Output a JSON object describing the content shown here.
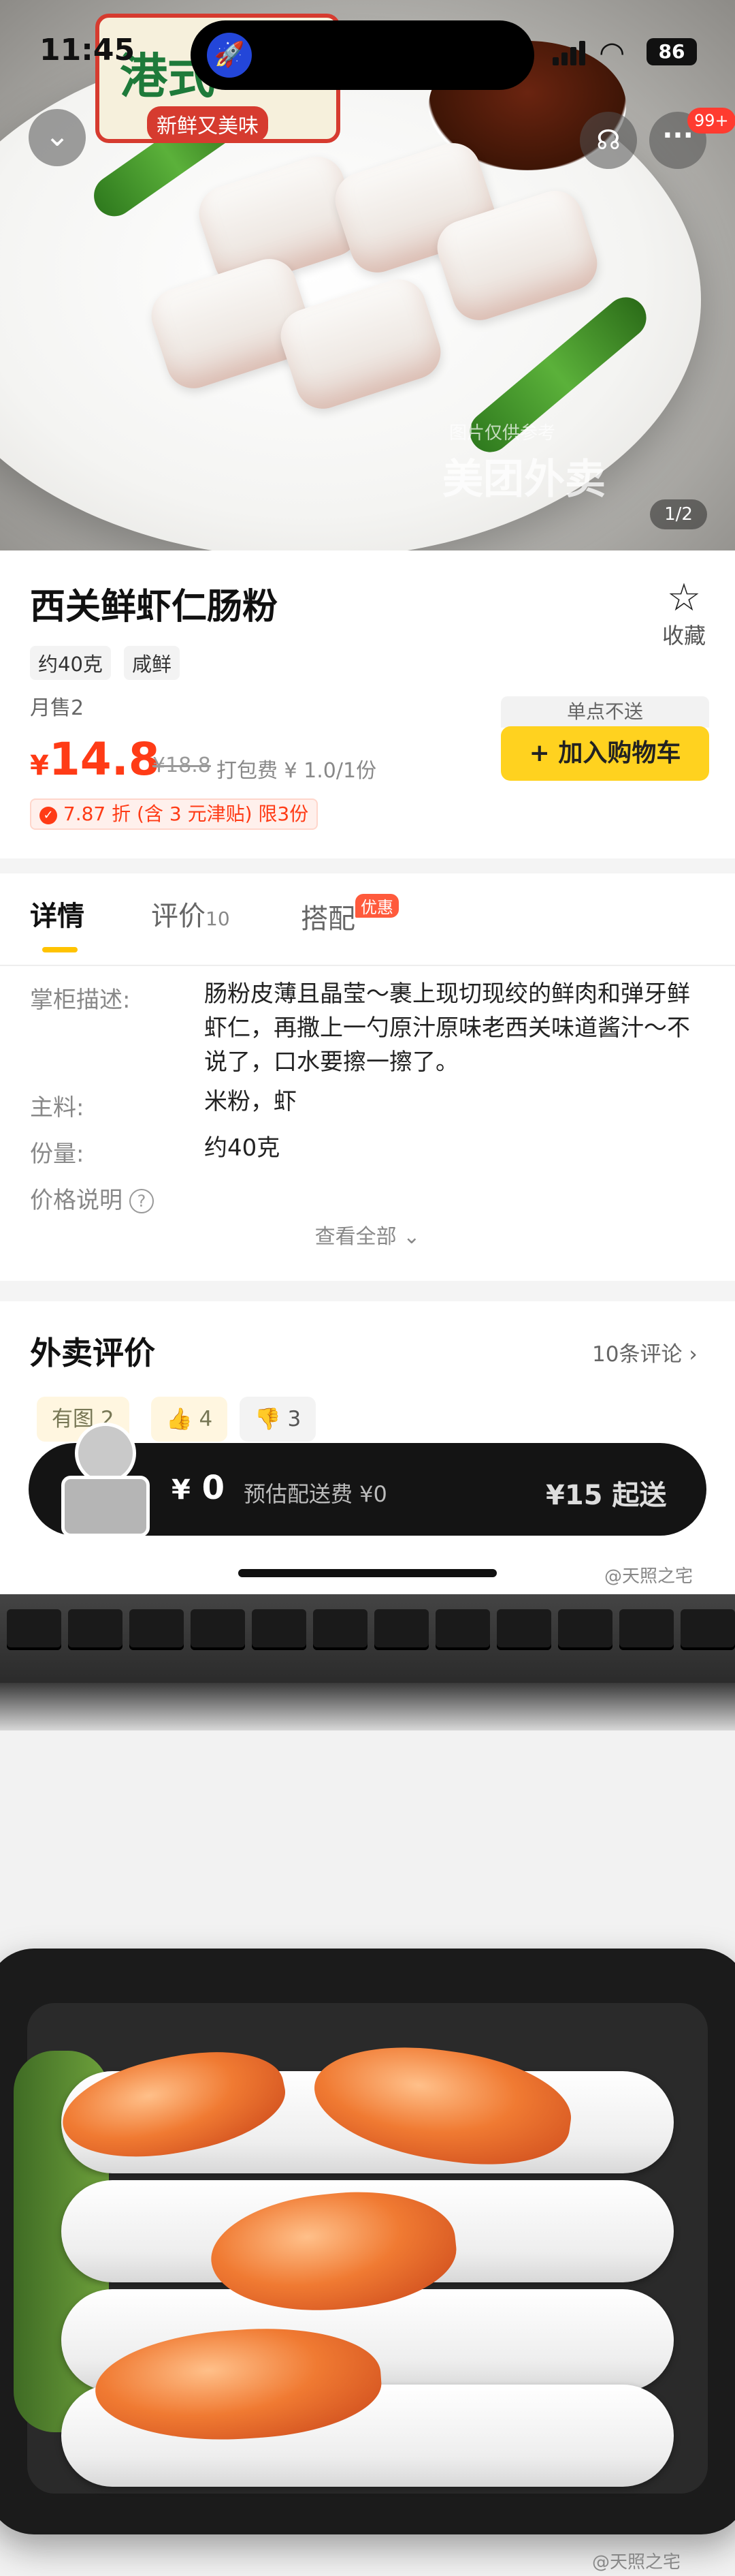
{
  "status_bar": {
    "time": "11:45",
    "battery": "86"
  },
  "hero": {
    "brand_main": "港式",
    "brand_sub": "新鲜又美味",
    "watermark": "美团外卖",
    "watermark_small": "图片仅供参考",
    "image_counter": "1/2",
    "more_badge": "99+"
  },
  "product": {
    "name": "西关鲜虾仁肠粉",
    "favorite_label": "收藏",
    "tags": [
      "约40克",
      "咸鲜"
    ],
    "monthly_sales": "月售2",
    "currency": "¥",
    "price": "14.8",
    "original_price": "¥18.8",
    "packing_fee": "打包费 ¥ 1.0/1份",
    "discount": "7.87 折 (含 3 元津贴)  限3份",
    "not_sold_single": "单点不送",
    "add_to_cart": "+ 加入购物车"
  },
  "tabs": [
    {
      "label": "详情",
      "count": ""
    },
    {
      "label": "评价",
      "count": "10"
    },
    {
      "label": "搭配",
      "badge": "优惠"
    }
  ],
  "details": {
    "desc_label": "掌柜描述:",
    "desc_value": "肠粉皮薄且晶莹～裹上现切现绞的鲜肉和弹牙鲜虾仁，再撒上一勺原汁原味老西关味道酱汁～不说了，口水要擦一擦了。",
    "main_label": "主料:",
    "main_value": "米粉，虾",
    "portion_label": "份量:",
    "portion_value": "约40克",
    "price_note_label": "价格说明",
    "see_all": "查看全部"
  },
  "reviews": {
    "title": "外卖评价",
    "count": "10条评论",
    "chips": [
      "有图 2",
      "4",
      "3"
    ]
  },
  "bottom_bar": {
    "currency": "¥",
    "cart_total": "0",
    "delivery_fee": "预估配送费 ¥0",
    "min_order": "¥15 起送"
  },
  "watermarks": {
    "weibo": "@天照之宅"
  }
}
